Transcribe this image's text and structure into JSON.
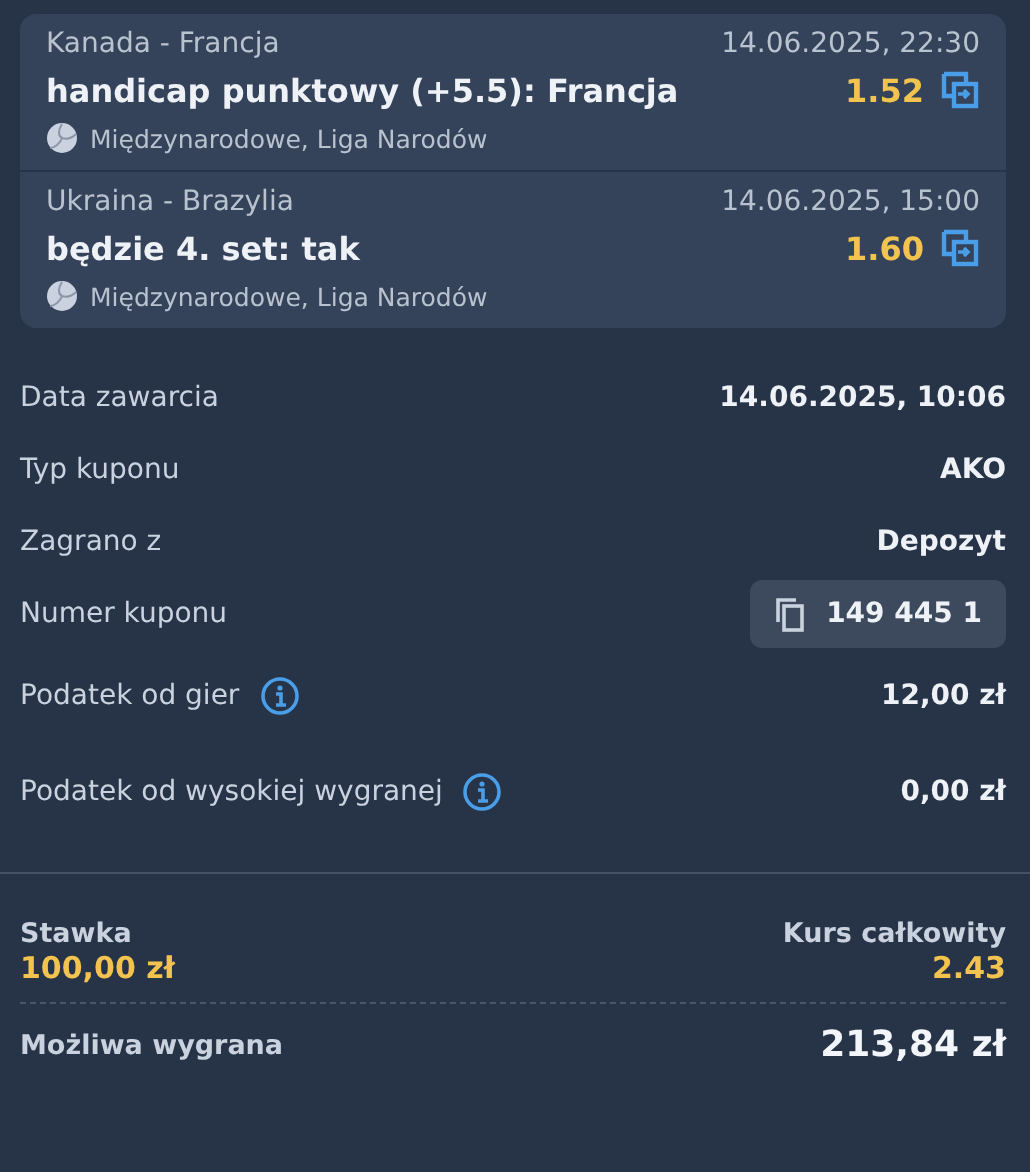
{
  "bets": [
    {
      "event": "Kanada - Francja",
      "datetime": "14.06.2025, 22:30",
      "selection": "handicap punktowy (+5.5): Francja",
      "odds": "1.52",
      "league": "Międzynarodowe, Liga Narodów"
    },
    {
      "event": "Ukraina - Brazylia",
      "datetime": "14.06.2025, 15:00",
      "selection": "będzie 4. set: tak",
      "odds": "1.60",
      "league": "Międzynarodowe, Liga Narodów"
    }
  ],
  "details": [
    {
      "kind": "plain",
      "label": "Data zawarcia",
      "value": "14.06.2025, 10:06"
    },
    {
      "kind": "plain",
      "label": "Typ kuponu",
      "value": "AKO"
    },
    {
      "kind": "plain",
      "label": "Zagrano z",
      "value": "Depozyt"
    },
    {
      "kind": "coupon",
      "label": "Numer kuponu",
      "value": "149 445 1"
    },
    {
      "kind": "info",
      "label": "Podatek od gier",
      "value": "12,00 zł"
    },
    {
      "kind": "info",
      "label": "Podatek od wysokiej wygranej",
      "value": "0,00 zł"
    }
  ],
  "summary": {
    "stake_label": "Stawka",
    "stake": "100,00 zł",
    "total_odds_label": "Kurs całkowity",
    "total_odds": "2.43",
    "win_label": "Możliwa wygrana",
    "win": "213,84 zł"
  }
}
